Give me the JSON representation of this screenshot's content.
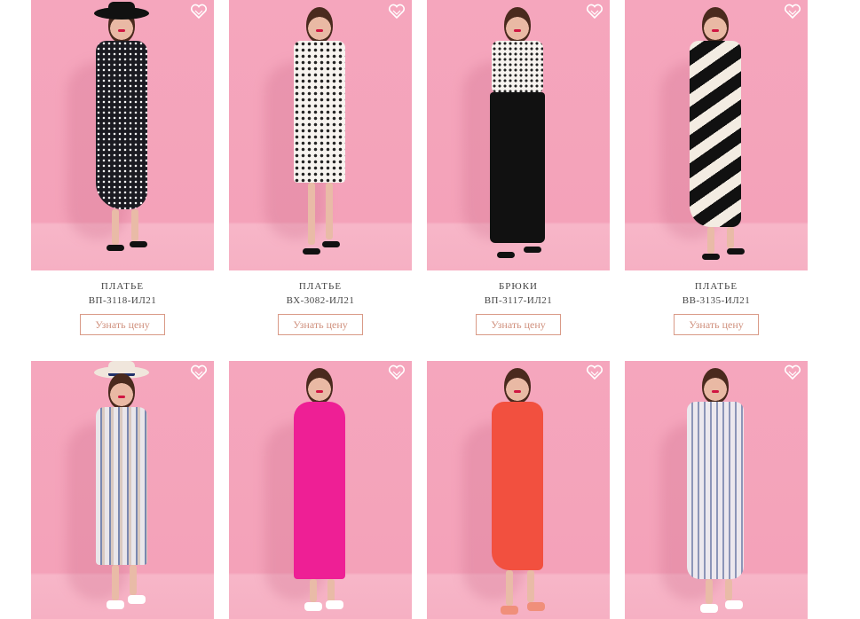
{
  "colors": {
    "background": "#f4a2b9",
    "button_border": "#d99a87",
    "button_text": "#d0917e",
    "text": "#444444"
  },
  "icons": {
    "favorite": "heart-outline-icon"
  },
  "products_row1": [
    {
      "name": "ПЛАТЬЕ",
      "sku": "ВП-3118-ИЛ21",
      "button": "Узнать цену",
      "outfit": "black-polka-dress"
    },
    {
      "name": "ПЛАТЬЕ",
      "sku": "ВХ-3082-ИЛ21",
      "button": "Узнать цену",
      "outfit": "white-dotted-dress"
    },
    {
      "name": "БРЮКИ",
      "sku": "ВП-3117-ИЛ21",
      "button": "Узнать цену",
      "outfit": "black-wide-trousers"
    },
    {
      "name": "ПЛАТЬЕ",
      "sku": "ВВ-3135-ИЛ21",
      "button": "Узнать цену",
      "outfit": "black-white-stripe-dress"
    }
  ],
  "products_row2": [
    {
      "outfit": "striped-shirt-dress"
    },
    {
      "outfit": "fuchsia-dress"
    },
    {
      "outfit": "coral-dress"
    },
    {
      "outfit": "grey-stripe-dress"
    }
  ]
}
